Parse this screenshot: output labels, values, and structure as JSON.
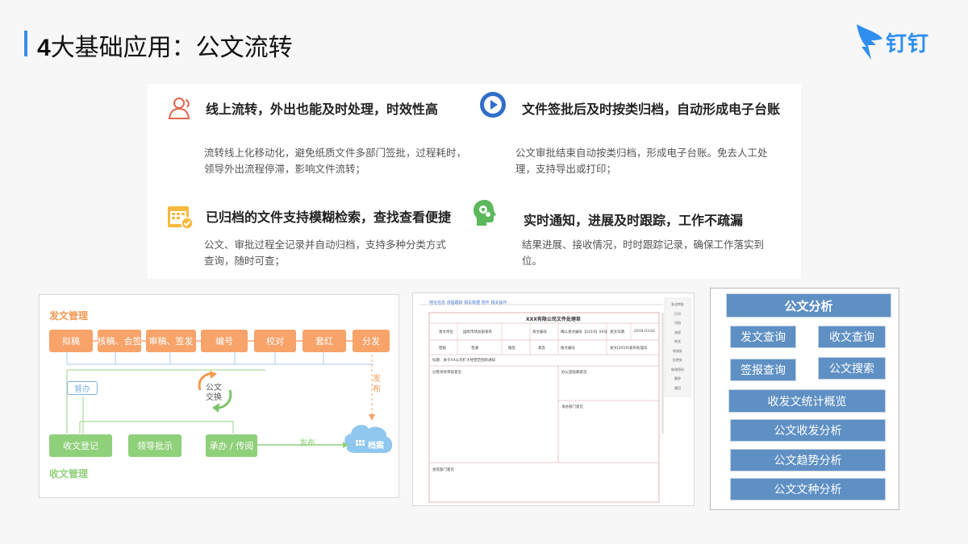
{
  "header": {
    "title_num": "4",
    "title_text": "大基础应用：公文流转",
    "logo_text": "钉钉",
    "accent": "#3b8de6"
  },
  "features": [
    {
      "icon": "user-group-icon",
      "title": "线上流转，外出也能及时处理，时效性高",
      "desc1": "流转线上化移动化，避免纸质文件多部门签批，过程耗时，",
      "desc2": "领导外出流程停滞，影响文件流转；"
    },
    {
      "icon": "play-circle-icon",
      "title": "文件签批后及时按类归档，自动形成电子台账",
      "desc1": "公文审批结束自动按类归档，形成电子台账。免去人工处",
      "desc2": "理，支持导出或打印；"
    },
    {
      "icon": "calendar-check-icon",
      "title": "已归档的文件支持模糊检索，查找查看便捷",
      "desc1": "公文、审批过程全记录并自动归档，支持多种分类方式",
      "desc2": "查询，随时可查；"
    },
    {
      "icon": "head-gear-icon",
      "title": "实时通知，进展及时跟踪，工作不疏漏",
      "desc1": "结果进展、接收情况，时时跟踪记录，确保工作落实到",
      "desc2": "位。"
    }
  ],
  "flow": {
    "send_section": "发文管理",
    "recv_section": "收文管理",
    "send_steps": [
      "拟稿",
      "核稿、会签",
      "审稿、签发",
      "编号",
      "校对",
      "套红",
      "分发"
    ],
    "recv_steps": [
      "收文登记",
      "领导批示",
      "承办 / 传阅"
    ],
    "side_label": "督办",
    "exchange_label_1": "公文",
    "exchange_label_2": "交换",
    "publish_label_1": "发",
    "publish_label_2": "布",
    "publish_label_h": "发布",
    "archive_label": "档案",
    "orange": "#f7a36a",
    "green": "#8fd07a"
  },
  "form": {
    "tabs": "地址信息  流程跟踪  相关数据  附件  相关操作",
    "title": "XXX有限公司文件处理单",
    "row1": [
      "发文单位",
      "国际市场总部发布",
      "发文编号",
      "确认发文编号【2019】XX号",
      "发文日期",
      "2019-03-02"
    ],
    "row2": [
      "密级",
      "普通",
      "缓急",
      "紧急",
      "收文编号",
      "发文[2019]发布处理号"
    ],
    "subject": "标题：关于XX公司扩大经营范围的通知",
    "sec1": "分管领导审核意见",
    "sec2": "办公室核稿意见",
    "sec3": "承办部门意见",
    "sec4": "会签部门意见",
    "side_actions": [
      "发送审批",
      "打印",
      "归档",
      "流程",
      "转发",
      "转阅处",
      "拒绝处",
      "修改密码",
      "删除",
      "撤回"
    ]
  },
  "analysis": {
    "header": "公文分析",
    "items": [
      "发文查询",
      "收文查询",
      "签报查询",
      "公文搜索",
      "收发文统计概览",
      "公文收发分析",
      "公文趋势分析",
      "公文文种分析"
    ],
    "color": "#5f90c4"
  }
}
